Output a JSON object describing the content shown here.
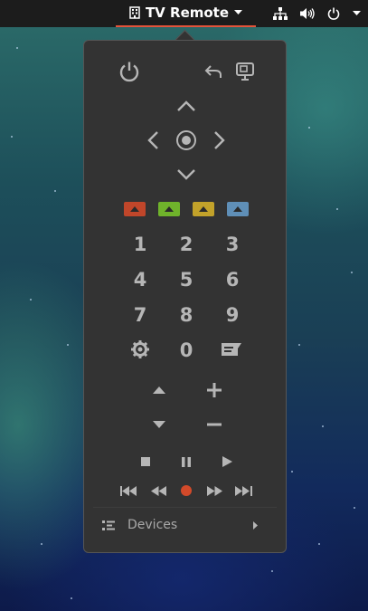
{
  "topbar": {
    "app_title": "TV Remote",
    "app_icon": "building-grid-icon",
    "tray_icons": [
      "network-icon",
      "volume-icon",
      "power-icon",
      "chevron-down-icon"
    ]
  },
  "remote": {
    "top_buttons": [
      "power-icon",
      "back-icon",
      "source-input-icon"
    ],
    "color_buttons": [
      "#c0462a",
      "#6fb32b",
      "#c2a22a",
      "#5f8fb7"
    ],
    "numbers": [
      "1",
      "2",
      "3",
      "4",
      "5",
      "6",
      "7",
      "8",
      "9",
      "0"
    ],
    "devices_label": "Devices"
  },
  "colors": {
    "accent": "#e5533a",
    "record": "#d24a2a",
    "popup_bg": "#333333",
    "icon": "#b6b6b6"
  }
}
